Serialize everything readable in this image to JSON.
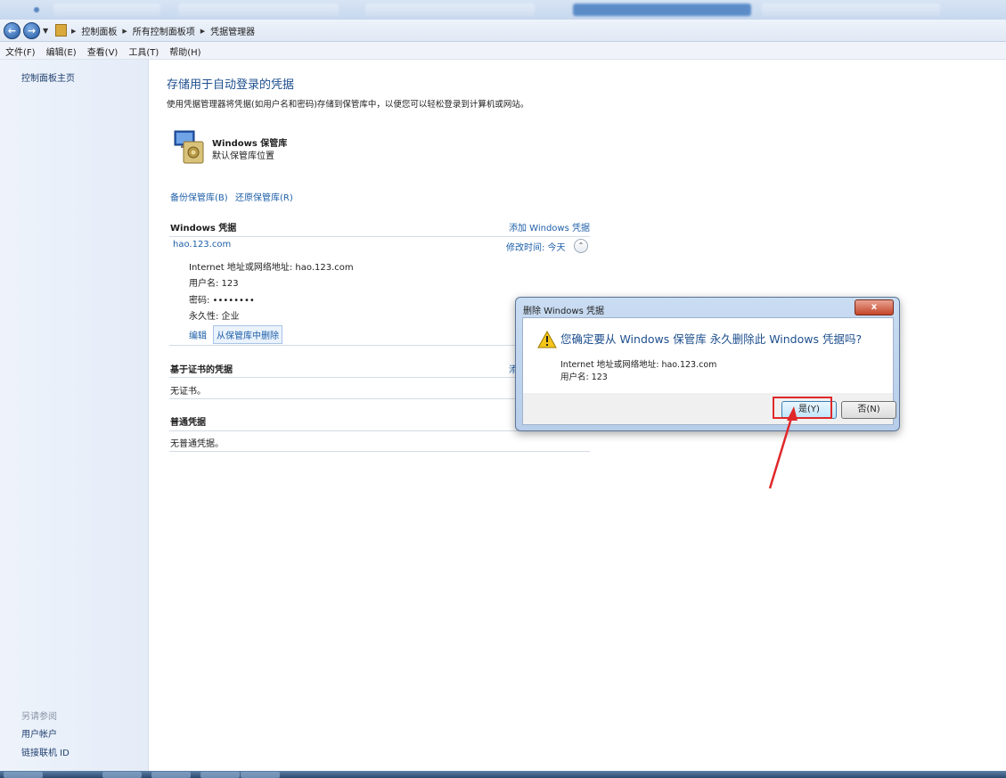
{
  "breadcrumb": {
    "items": [
      "控制面板",
      "所有控制面板项",
      "凭据管理器"
    ]
  },
  "menu": {
    "items": [
      "文件(F)",
      "编辑(E)",
      "查看(V)",
      "工具(T)",
      "帮助(H)"
    ]
  },
  "sidebar": {
    "home": "控制面板主页",
    "see_also": "另请参阅",
    "links": [
      "用户帐户",
      "链接联机 ID"
    ]
  },
  "main": {
    "title": "存储用于自动登录的凭据",
    "description": "使用凭据管理器将凭据(如用户名和密码)存储到保管库中，以便您可以轻松登录到计算机或网站。",
    "vault": {
      "name": "Windows 保管库",
      "location": "默认保管库位置"
    },
    "backup_link": "备份保管库(B)",
    "restore_link": "还原保管库(R)",
    "windows_credentials": {
      "heading": "Windows 凭据",
      "add_link": "添加 Windows 凭据",
      "entry": {
        "name": "hao.123.com",
        "modified": "修改时间:  今天",
        "address": "Internet 地址或网络地址:  hao.123.com",
        "username": "用户名:  123",
        "password": "密码:  ••••••••",
        "persistence": "永久性:  企业",
        "edit": "编辑",
        "remove": "从保管库中删除"
      }
    },
    "certificate_credentials": {
      "heading": "基于证书的凭据",
      "add_link_partial": "添",
      "empty": "无证书。"
    },
    "generic_credentials": {
      "heading": "普通凭据",
      "empty": "无普通凭据。"
    }
  },
  "dialog": {
    "title": "删除 Windows 凭据",
    "close": "x",
    "question": "您确定要从 Windows 保管库 永久删除此 Windows 凭据吗?",
    "address": "Internet 地址或网络地址: hao.123.com",
    "username": "用户名: 123",
    "yes": "是(Y)",
    "no": "否(N)"
  },
  "colors": {
    "link": "#1e5fa8",
    "title": "#1e4f8e",
    "highlight": "#e0282a"
  }
}
